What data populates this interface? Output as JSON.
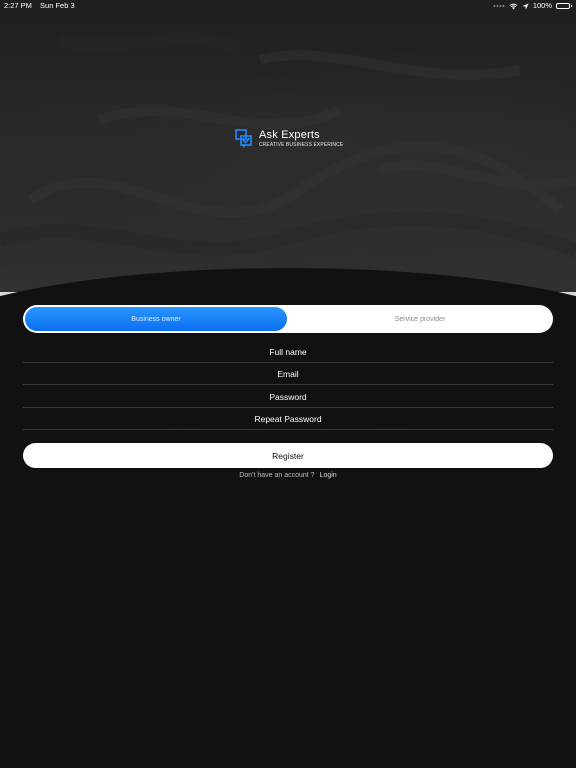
{
  "status_bar": {
    "time": "2:27 PM",
    "date": "Sun Feb 3",
    "battery": "100%",
    "icons": [
      "wifi-icon",
      "location-arrow-icon",
      "battery-icon"
    ]
  },
  "logo": {
    "icon": "chat-check-icon",
    "title": "Ask Experts",
    "subtitle": "CREATIVE BUSINESS EXPERINCE"
  },
  "segment": {
    "options": [
      {
        "label": "Business owner",
        "selected": true
      },
      {
        "label": "Service provider",
        "selected": false
      }
    ]
  },
  "form": {
    "full_name_placeholder": "Full name",
    "email_placeholder": "Email",
    "password_placeholder": "Password",
    "repeat_password_placeholder": "Repeat Password",
    "register_label": "Register"
  },
  "footer": {
    "prompt": "Don't have an account ?",
    "login_label": "Login"
  },
  "colors": {
    "background": "#111111",
    "accent": "#0a7af5",
    "field_divider": "#3a3a3a"
  }
}
